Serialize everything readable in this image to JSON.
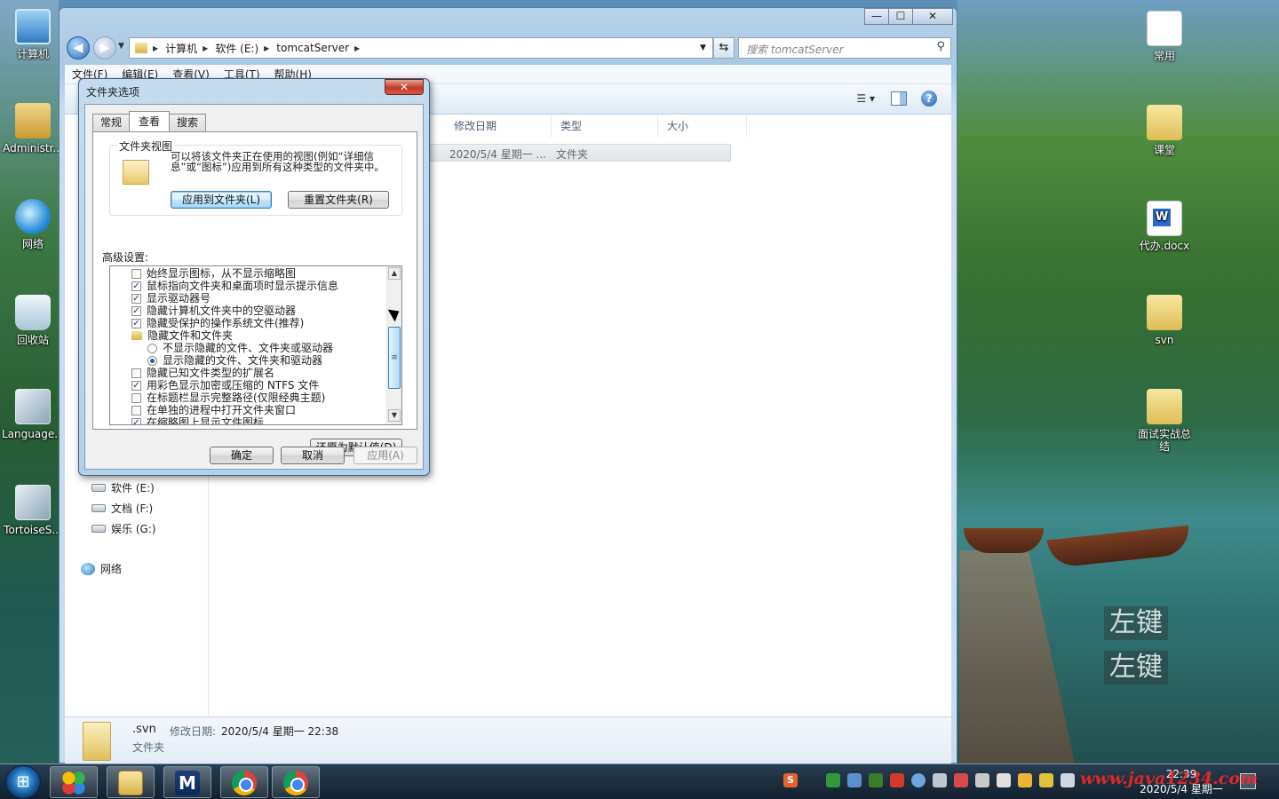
{
  "desktop": {
    "left_icons": [
      {
        "label": "计算机",
        "icon": "computer-icon"
      },
      {
        "label": "Administr...",
        "icon": "user-folder-icon"
      },
      {
        "label": "网络",
        "icon": "network-icon"
      },
      {
        "label": "回收站",
        "icon": "recycle-bin-icon"
      },
      {
        "label": "Language...",
        "icon": "installer-icon"
      },
      {
        "label": "TortoiseS...",
        "icon": "installer-icon"
      }
    ],
    "right_icons": [
      {
        "label": "常用",
        "icon": "shortcut-icon"
      },
      {
        "label": "课堂",
        "icon": "folder-shortcut-icon"
      },
      {
        "label": "代办.docx",
        "icon": "word-document-icon"
      },
      {
        "label": "svn",
        "icon": "folder-shortcut-icon"
      },
      {
        "label": "面试实战总结",
        "icon": "folder-icon"
      }
    ],
    "key_overlays": [
      "左键",
      "左键"
    ]
  },
  "explorer": {
    "breadcrumb": [
      "计算机",
      "软件 (E:)",
      "tomcatServer"
    ],
    "search_placeholder": "搜索 tomcatServer",
    "menu": [
      "文件(F)",
      "编辑(E)",
      "查看(V)",
      "工具(T)",
      "帮助(H)"
    ],
    "columns": [
      "修改日期",
      "类型",
      "大小"
    ],
    "row": {
      "modified": "2020/5/4 星期一 ...",
      "type": "文件夹"
    },
    "nav_items": [
      "软件 (E:)",
      "文档 (F:)",
      "娱乐 (G:)",
      "网络"
    ],
    "details": {
      "name": ".svn",
      "modified_label": "修改日期:",
      "modified_value": "2020/5/4 星期一 22:38",
      "type": "文件夹"
    },
    "window_controls": [
      "—",
      "☐",
      "✕"
    ]
  },
  "dialog": {
    "title": "文件夹选项",
    "close": "✕",
    "tabs": [
      "常规",
      "查看",
      "搜索"
    ],
    "active_tab": "查看",
    "folder_views": {
      "title": "文件夹视图",
      "text": "可以将该文件夹正在使用的视图(例如“详细信息”或“图标”)应用到所有这种类型的文件夹中。",
      "apply_button": "应用到文件夹(L)",
      "reset_button": "重置文件夹(R)"
    },
    "advanced_label": "高级设置:",
    "settings": [
      {
        "type": "checkbox",
        "checked": false,
        "label": "始终显示图标，从不显示缩略图"
      },
      {
        "type": "checkbox",
        "checked": true,
        "label": "鼠标指向文件夹和桌面项时显示提示信息"
      },
      {
        "type": "checkbox",
        "checked": true,
        "label": "显示驱动器号"
      },
      {
        "type": "checkbox",
        "checked": true,
        "label": "隐藏计算机文件夹中的空驱动器"
      },
      {
        "type": "checkbox",
        "checked": true,
        "label": "隐藏受保护的操作系统文件(推荐)"
      },
      {
        "type": "folder",
        "label": "隐藏文件和文件夹"
      },
      {
        "type": "radio",
        "checked": false,
        "label": "不显示隐藏的文件、文件夹或驱动器"
      },
      {
        "type": "radio",
        "checked": true,
        "label": "显示隐藏的文件、文件夹和驱动器"
      },
      {
        "type": "checkbox",
        "checked": false,
        "label": "隐藏已知文件类型的扩展名"
      },
      {
        "type": "checkbox",
        "checked": true,
        "label": "用彩色显示加密或压缩的 NTFS 文件"
      },
      {
        "type": "checkbox",
        "checked": false,
        "label": "在标题栏显示完整路径(仅限经典主题)"
      },
      {
        "type": "checkbox",
        "checked": false,
        "label": "在单独的进程中打开文件夹窗口"
      },
      {
        "type": "checkbox",
        "checked": true,
        "label": "在缩略图上显示文件图标"
      }
    ],
    "restore_button": "还原为默认值(D)",
    "ok_button": "确定",
    "cancel_button": "取消",
    "apply_button": "应用(A)"
  },
  "taskbar": {
    "start_label": "⊞",
    "clock_time": "22:39",
    "clock_date": "2020/5/4 星期一",
    "watermark": "www.java1234.com"
  }
}
